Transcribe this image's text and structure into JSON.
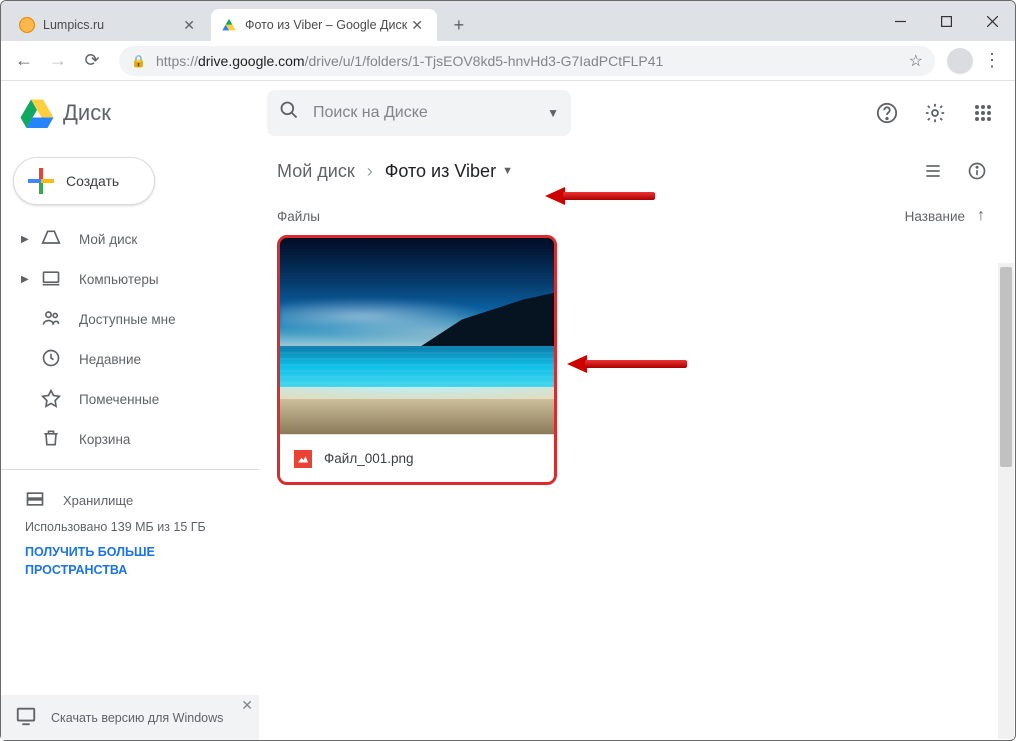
{
  "window": {
    "tabs": [
      {
        "title": "Lumpics.ru",
        "active": false
      },
      {
        "title": "Фото из Viber – Google Диск",
        "active": true
      }
    ]
  },
  "addressbar": {
    "protocol": "https://",
    "host": "drive.google.com",
    "path": "/drive/u/1/folders/1-TjsEOV8kd5-hnvHd3-G7IadPCtFLP41"
  },
  "app": {
    "logo_text": "Диск",
    "search_placeholder": "Поиск на Диске"
  },
  "sidebar": {
    "create_label": "Создать",
    "items": [
      {
        "label": "Мой диск",
        "expandable": true
      },
      {
        "label": "Компьютеры",
        "expandable": true
      },
      {
        "label": "Доступные мне",
        "expandable": false
      },
      {
        "label": "Недавние",
        "expandable": false
      },
      {
        "label": "Помеченные",
        "expandable": false
      },
      {
        "label": "Корзина",
        "expandable": false
      }
    ],
    "storage": {
      "title": "Хранилище",
      "usage": "Использовано 139 МБ из 15 ГБ",
      "upgrade": "ПОЛУЧИТЬ БОЛЬШЕ ПРОСТРАНСТВА"
    },
    "promo": "Скачать версию для Windows"
  },
  "main": {
    "breadcrumb": [
      {
        "label": "Мой диск",
        "current": false
      },
      {
        "label": "Фото из Viber",
        "current": true
      }
    ],
    "section_label": "Файлы",
    "sort_label": "Название",
    "files": [
      {
        "name": "Файл_001.png",
        "type": "image"
      }
    ]
  }
}
